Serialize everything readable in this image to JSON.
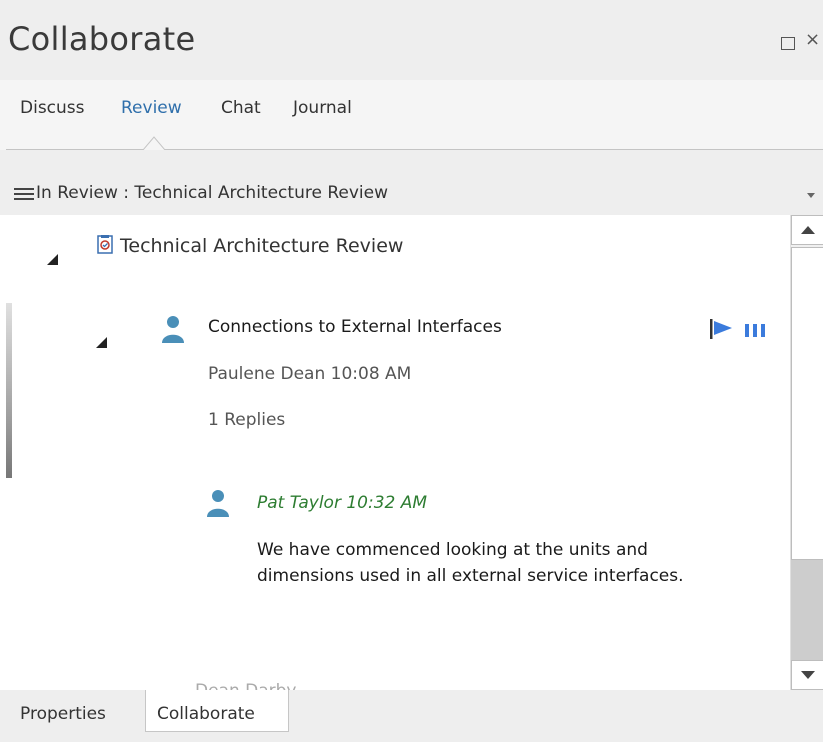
{
  "panel": {
    "title": "Collaborate",
    "maximize_icon": "maximize-icon",
    "close_icon": "close-icon",
    "close_glyph": "×"
  },
  "tabs": [
    {
      "label": "Discuss",
      "active": false
    },
    {
      "label": "Review",
      "active": true
    },
    {
      "label": "Chat",
      "active": false
    },
    {
      "label": "Journal",
      "active": false
    }
  ],
  "review_header": {
    "menu_icon": "hamburger-icon",
    "label": "In Review : Technical Architecture Review",
    "dropdown_icon": "chevron-down-icon"
  },
  "tree": {
    "review_node": {
      "label": "Technical Architecture Review",
      "icon": "review-document-icon"
    },
    "discussion": {
      "title": "Connections to External Interfaces",
      "meta": "Paulene Dean  10:08 AM",
      "replies": "1 Replies",
      "status_icon": "flag-icon",
      "priority_icon": "priority-bars-icon",
      "accent_color": "#3b7bdc"
    },
    "reply": {
      "author": "Pat Taylor  10:32 AM",
      "author_color": "#2e7d32",
      "body": "We have commenced looking at the units and dimensions used in all external service interfaces."
    },
    "cutoff_text": "Dean Darby"
  },
  "bottom_tabs": [
    {
      "label": "Properties",
      "active": false
    },
    {
      "label": "Collaborate",
      "active": true
    }
  ],
  "colors": {
    "user_icon": "#4a8fb8",
    "active_tab": "#2f6fab"
  }
}
